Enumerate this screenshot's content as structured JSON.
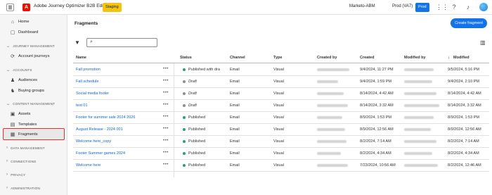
{
  "topbar": {
    "app_title": "Adobe Journey Optimizer B2B Edition",
    "env_badge": "Staging",
    "org_name": "Marketo-ABM",
    "sandbox": "Prod (VA7)",
    "prod_badge": "Prod",
    "icons": [
      "apps-grid-icon",
      "help-icon",
      "bell-icon",
      "avatar"
    ]
  },
  "sidebar": {
    "top_items": [
      {
        "label": "Home",
        "icon": "home-icon"
      },
      {
        "label": "Dashboard",
        "icon": "dashboard-icon"
      }
    ],
    "sections": [
      {
        "title": "JOURNEY MANAGEMENT",
        "items": [
          {
            "label": "Account journeys",
            "icon": "journey-icon"
          }
        ]
      },
      {
        "title": "ACCOUNTS",
        "items": [
          {
            "label": "Audiences",
            "icon": "audiences-icon"
          },
          {
            "label": "Buying groups",
            "icon": "buying-groups-icon"
          }
        ]
      },
      {
        "title": "CONTENT MANAGEMENT",
        "items": [
          {
            "label": "Assets",
            "icon": "assets-icon"
          },
          {
            "label": "Templates",
            "icon": "templates-icon"
          },
          {
            "label": "Fragments",
            "icon": "fragments-icon",
            "selected": true
          }
        ]
      },
      {
        "title": "DATA MANAGEMENT",
        "collapsed": true
      },
      {
        "title": "CONNECTIONS",
        "collapsed": true
      },
      {
        "title": "PRIVACY",
        "collapsed": true
      },
      {
        "title": "ADMINISTRATION",
        "collapsed": true
      }
    ]
  },
  "main": {
    "title": "Fragments",
    "create_button": "Create fragment",
    "search_placeholder": "",
    "columns": [
      "Name",
      "Status",
      "Channel",
      "Type",
      "Created by",
      "Created",
      "Modified by",
      "Modified"
    ],
    "sort_column": "Modified",
    "sort_direction": "descending",
    "rows": [
      {
        "name": "Fall promotion",
        "status": "Published with dra",
        "status_kind": "published",
        "channel": "Email",
        "type": "Visual",
        "created": "9/4/2024, 11:27 PM",
        "modified": "9/5/2024, 5:16 PM"
      },
      {
        "name": "Fall schedule",
        "status": "Draft",
        "status_kind": "draft",
        "channel": "Email",
        "type": "Visual",
        "created": "9/4/2024, 1:59 PM",
        "modified": "9/4/2024, 2:10 PM"
      },
      {
        "name": "Social media footer",
        "status": "Draft",
        "status_kind": "draft",
        "channel": "Email",
        "type": "Visual",
        "created": "8/14/2024, 4:42 AM",
        "modified": "8/14/2024, 4:42 AM"
      },
      {
        "name": "test 01",
        "status": "Draft",
        "status_kind": "draft",
        "channel": "Email",
        "type": "Visual",
        "created": "8/14/2024, 3:32 AM",
        "modified": "8/14/2024, 3:32 AM"
      },
      {
        "name": "Footer for summer sale 2024 2026",
        "status": "Published",
        "status_kind": "published",
        "channel": "Email",
        "type": "Visual",
        "created": "8/9/2024, 1:53 PM",
        "modified": "8/9/2024, 1:53 PM"
      },
      {
        "name": "August Release - 2024 001",
        "status": "Published",
        "status_kind": "published",
        "channel": "Email",
        "type": "Visual",
        "created": "8/9/2024, 12:56 AM",
        "modified": "8/9/2024, 12:56 AM"
      },
      {
        "name": "Welcome here_copy",
        "status": "Published",
        "status_kind": "published",
        "channel": "Email",
        "type": "Visual",
        "created": "8/2/2024, 7:14 AM",
        "modified": "8/2/2024, 7:14 AM"
      },
      {
        "name": "Footer Summer games 2024",
        "status": "Published",
        "status_kind": "published",
        "channel": "Email",
        "type": "Visual",
        "created": "8/2/2024, 4:34 AM",
        "modified": "8/2/2024, 4:34 AM"
      },
      {
        "name": "Welcome here",
        "status": "Published",
        "status_kind": "published",
        "channel": "Email",
        "type": "Visual",
        "created": "7/23/2024, 10:56 AM",
        "modified": "8/2/2024, 12:46 AM"
      }
    ],
    "colors": {
      "published": "#2d9d78",
      "draft": "#8e8e8e",
      "accent": "#1473e6",
      "link": "#1463cc"
    }
  }
}
